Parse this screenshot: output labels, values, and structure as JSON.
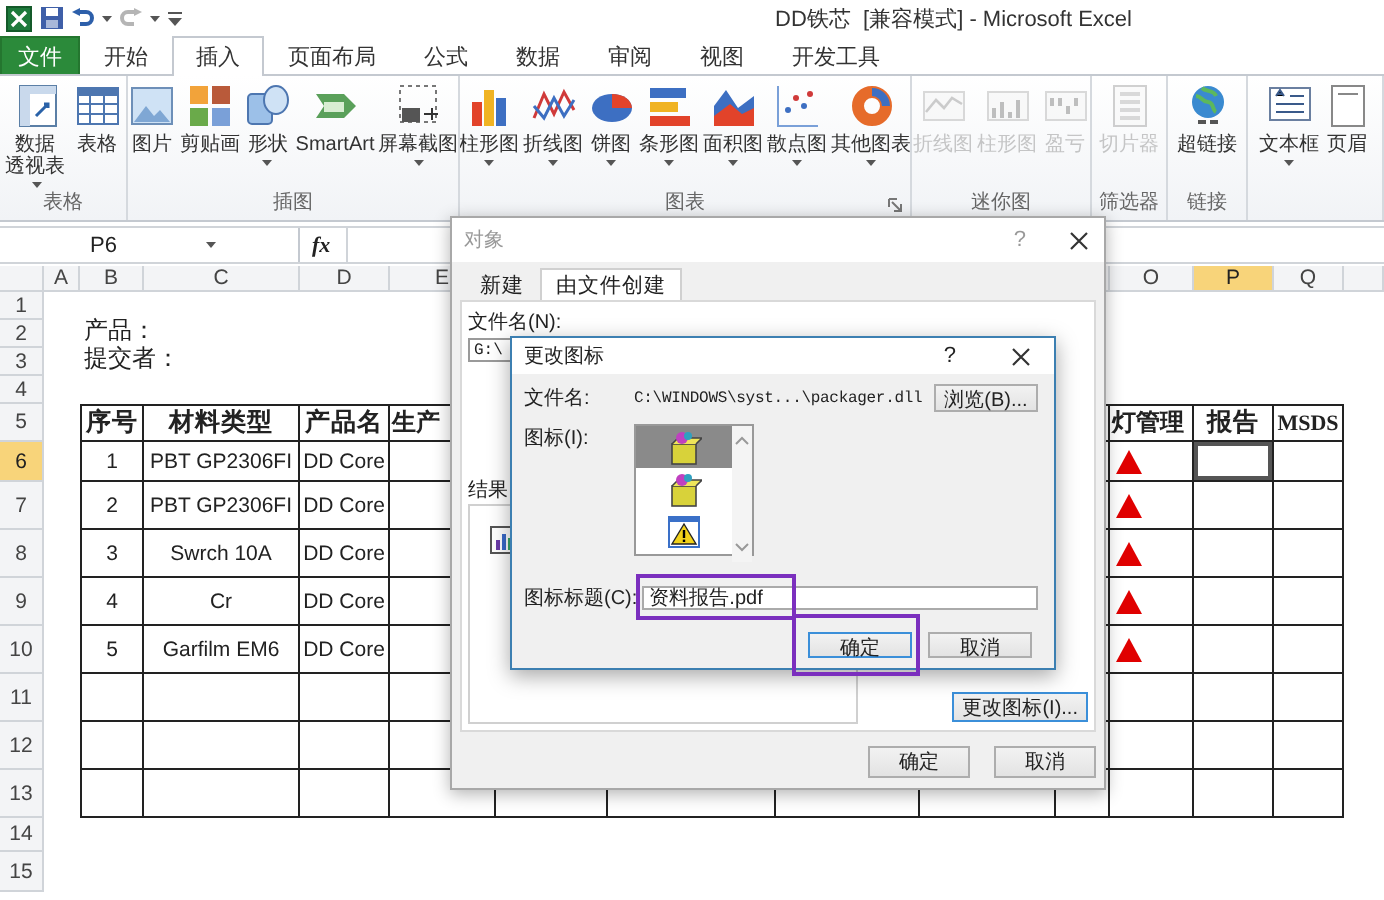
{
  "window": {
    "title": "DD铁芯  [兼容模式] - Microsoft Excel"
  },
  "ribbon_tabs": [
    {
      "label": "文件",
      "kind": "file",
      "selected": false
    },
    {
      "label": "开始",
      "kind": "tab",
      "selected": false
    },
    {
      "label": "插入",
      "kind": "tab",
      "selected": true
    },
    {
      "label": "页面布局",
      "kind": "tab",
      "selected": false
    },
    {
      "label": "公式",
      "kind": "tab",
      "selected": false
    },
    {
      "label": "数据",
      "kind": "tab",
      "selected": false
    },
    {
      "label": "审阅",
      "kind": "tab",
      "selected": false
    },
    {
      "label": "视图",
      "kind": "tab",
      "selected": false
    },
    {
      "label": "开发工具",
      "kind": "tab",
      "selected": false
    }
  ],
  "ribbon_groups": [
    {
      "label": "表格",
      "buttons": [
        {
          "label": "数据透视表",
          "dropdown": true,
          "disabled": false
        },
        {
          "label": "表格",
          "dropdown": false,
          "disabled": false
        }
      ]
    },
    {
      "label": "插图",
      "buttons": [
        {
          "label": "图片",
          "dropdown": false,
          "disabled": false
        },
        {
          "label": "剪贴画",
          "dropdown": false,
          "disabled": false
        },
        {
          "label": "形状",
          "dropdown": true,
          "disabled": false
        },
        {
          "label": "SmartArt",
          "dropdown": false,
          "disabled": false
        },
        {
          "label": "屏幕截图",
          "dropdown": true,
          "disabled": false
        }
      ]
    },
    {
      "label": "图表",
      "launcher": true,
      "buttons": [
        {
          "label": "柱形图",
          "dropdown": true,
          "disabled": false
        },
        {
          "label": "折线图",
          "dropdown": true,
          "disabled": false
        },
        {
          "label": "饼图",
          "dropdown": true,
          "disabled": false
        },
        {
          "label": "条形图",
          "dropdown": true,
          "disabled": false
        },
        {
          "label": "面积图",
          "dropdown": true,
          "disabled": false
        },
        {
          "label": "散点图",
          "dropdown": true,
          "disabled": false
        },
        {
          "label": "其他图表",
          "dropdown": true,
          "disabled": false
        }
      ]
    },
    {
      "label": "迷你图",
      "buttons": [
        {
          "label": "折线图",
          "dropdown": false,
          "disabled": true
        },
        {
          "label": "柱形图",
          "dropdown": false,
          "disabled": true
        },
        {
          "label": "盈亏",
          "dropdown": false,
          "disabled": true
        }
      ]
    },
    {
      "label": "筛选器",
      "buttons": [
        {
          "label": "切片器",
          "dropdown": false,
          "disabled": true
        }
      ]
    },
    {
      "label": "链接",
      "buttons": [
        {
          "label": "超链接",
          "dropdown": false,
          "disabled": false
        }
      ]
    },
    {
      "buttons": [
        {
          "label": "文本框",
          "dropdown": true,
          "disabled": false
        },
        {
          "label": "页眉",
          "dropdown": false,
          "disabled": false
        }
      ]
    }
  ],
  "formula_bar": {
    "name_box": "P6",
    "fx": "fx"
  },
  "sheet": {
    "columns": [
      {
        "label": "A",
        "selected": false
      },
      {
        "label": "B",
        "selected": false
      },
      {
        "label": "C",
        "selected": false
      },
      {
        "label": "D",
        "selected": false
      },
      {
        "label": "E",
        "selected": false
      },
      {
        "label": "O",
        "selected": false
      },
      {
        "label": "P",
        "selected": true
      },
      {
        "label": "Q",
        "selected": false
      }
    ],
    "rows": [
      {
        "label": "1",
        "selected": false
      },
      {
        "label": "2",
        "selected": false
      },
      {
        "label": "3",
        "selected": false
      },
      {
        "label": "4",
        "selected": false
      },
      {
        "label": "5",
        "selected": false
      },
      {
        "label": "6",
        "selected": true
      },
      {
        "label": "7",
        "selected": false
      },
      {
        "label": "8",
        "selected": false
      },
      {
        "label": "9",
        "selected": false
      },
      {
        "label": "10",
        "selected": false
      },
      {
        "label": "11",
        "selected": false
      },
      {
        "label": "12",
        "selected": false
      },
      {
        "label": "13",
        "selected": false
      },
      {
        "label": "14",
        "selected": false
      },
      {
        "label": "15",
        "selected": false
      }
    ],
    "notes": [
      "产品：",
      "提交者："
    ],
    "table": {
      "headers": [
        "序号",
        "材料类型",
        "产品名",
        "生产",
        "灯管理",
        "报告",
        "MSDS"
      ],
      "rows": [
        {
          "no": "1",
          "material": "PBT GP2306FI",
          "product": "DD Core",
          "warning": true
        },
        {
          "no": "2",
          "material": "PBT GP2306FI",
          "product": "DD Core",
          "warning": true
        },
        {
          "no": "3",
          "material": "Swrch 10A",
          "product": "DD Core",
          "warning": true
        },
        {
          "no": "4",
          "material": "Cr",
          "product": "DD Core",
          "warning": true
        },
        {
          "no": "5",
          "material": "Garfilm EM6",
          "product": "DD Core",
          "warning": true
        }
      ]
    }
  },
  "object_dialog": {
    "title": "对象",
    "help": "?",
    "tabs": [
      {
        "label": "新建",
        "selected": false
      },
      {
        "label": "由文件创建",
        "selected": true
      }
    ],
    "file_label": "文件名(N):",
    "file_path": "G:\\",
    "result_label": "结果",
    "change_icon_button": "更改图标(I)...",
    "buttons": [
      "确定",
      "取消"
    ]
  },
  "icon_dialog": {
    "title": "更改图标",
    "help": "?",
    "file_label": "文件名:",
    "file_path": "C:\\WINDOWS\\syst...\\packager.dll",
    "browse_button": "浏览(B)...",
    "icons_label": "图标(I):",
    "icons": [
      {
        "kind": "package",
        "selected": true
      },
      {
        "kind": "package",
        "selected": false
      },
      {
        "kind": "warning",
        "selected": false
      }
    ],
    "caption_label": "图标标题(C):",
    "caption": {
      "value": "资料报告.pdf",
      "highlighted": true
    },
    "buttons": [
      {
        "label": "确定",
        "highlighted": true
      },
      {
        "label": "取消"
      }
    ]
  }
}
